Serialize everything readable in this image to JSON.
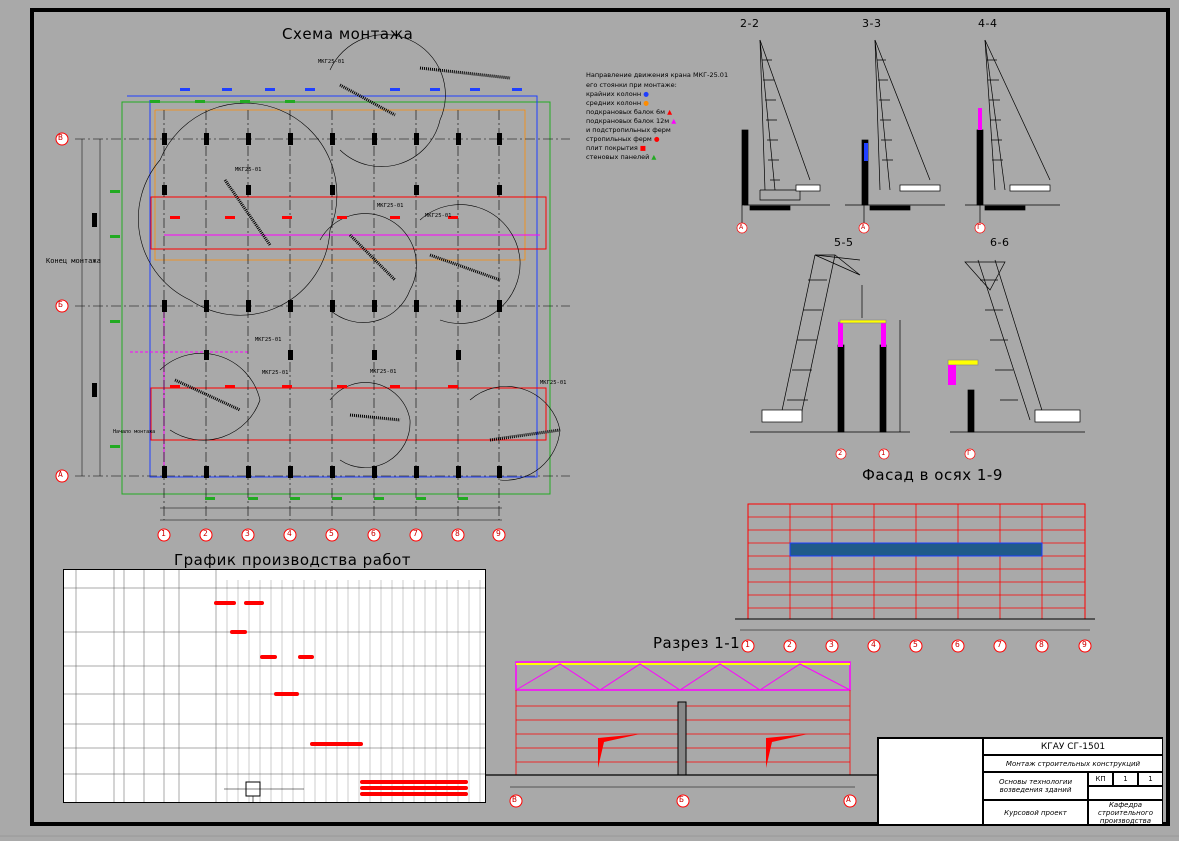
{
  "titles": {
    "mounting_scheme": "Схема монтажа",
    "section_2": "2-2",
    "section_3": "3-3",
    "section_4": "4-4",
    "section_5": "5-5",
    "section_6": "6-6",
    "facade": "Фасад в осях 1-9",
    "schedule": "График производства работ",
    "cut_1_1": "Разрез 1-1"
  },
  "legend": {
    "heading": "Направление движения крана МКГ-25.01",
    "subheading": "его стоянки при монтаже:",
    "items": [
      {
        "label": "крайних колонн",
        "color": "#1f3fff"
      },
      {
        "label": "средних колонн",
        "color": "#ff8c00"
      },
      {
        "label": "подкрановых балок 6м",
        "color": "#ff0000"
      },
      {
        "label": "подкрановых балок 12м",
        "color": "#ff00ff"
      },
      {
        "label": "и подстропильных ферм",
        "color": "#ff00ff"
      },
      {
        "label": "стропильных ферм",
        "color": "#ff0000"
      },
      {
        "label": "плит покрытия",
        "color": "#ff0000"
      },
      {
        "label": "стеновых панелей",
        "color": "#22aa22"
      }
    ]
  },
  "plan": {
    "crane_labels": [
      "МКГ25-01",
      "МКГ25-01",
      "МКГ25-01",
      "МКГ25-01",
      "МКГ25-01",
      "МКГ25-01",
      "МКГ25-01",
      "МКГ25-01"
    ],
    "side_label": "Конец монтажа",
    "start_label": "Начало монтажа",
    "row_axes": [
      "В",
      "Б",
      "А"
    ],
    "col_axes": [
      "1",
      "2",
      "3",
      "4",
      "5",
      "6",
      "7",
      "8",
      "9"
    ]
  },
  "facade_axes": [
    "1",
    "2",
    "3",
    "4",
    "5",
    "6",
    "7",
    "8",
    "9"
  ],
  "cut_axes": [
    "В",
    "Б",
    "А"
  ],
  "section_axes": {
    "s2": [
      "А"
    ],
    "s3": [
      "А"
    ],
    "s4": [
      "Г"
    ],
    "s5": [
      "2",
      "1"
    ],
    "s6": [
      "Г"
    ]
  },
  "stamp": {
    "code": "КГАУ СГ-1501",
    "project_title": "Монтаж строительных конструкций",
    "sheet_desc": "Основы технологии возведения зданий",
    "doc_type": "Курсовой проект",
    "org": "Кафедра строительного производства",
    "stage": "КП",
    "sheet": "1",
    "sheets": "1"
  },
  "colors": {
    "blue": "#1f3fff",
    "red": "#ff0000",
    "magenta": "#ff00ff",
    "green": "#22aa22",
    "orange": "#ff8c00",
    "panel_band": "#1f5a8a"
  }
}
